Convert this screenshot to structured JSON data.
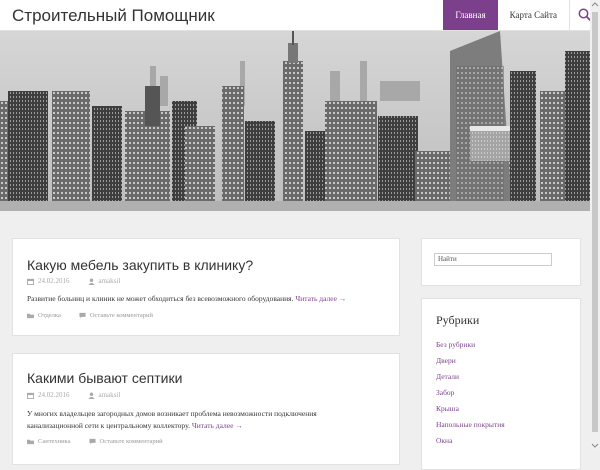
{
  "header": {
    "site_title": "Строительный Помощник",
    "nav": [
      {
        "label": "Главная",
        "active": true
      },
      {
        "label": "Карта Сайта",
        "active": false
      }
    ],
    "search_icon": "magnifier-icon",
    "accent_color": "#7b3f8c"
  },
  "posts": [
    {
      "title": "Какую мебель закупить в клинику?",
      "date": "24.02.2016",
      "author": "amaksil",
      "excerpt": "Развитие больниц и клиник не может обходиться без всевозможного оборудования.",
      "read_more": "Читать далее →",
      "category": "Отделка",
      "comment_link": "Оставьте комментарий"
    },
    {
      "title": "Какими бывают септики",
      "date": "24.02.2016",
      "author": "amaksil",
      "excerpt": "У многих владельцев загородных домов возникает проблема невозможности подключения канализационной сети к центральному коллектору.",
      "read_more": "Читать далее →",
      "category": "Сантехника",
      "comment_link": "Оставьте комментарий"
    }
  ],
  "sidebar": {
    "search_placeholder": "Найти",
    "categories_title": "Рубрики",
    "categories": [
      "Без рубрики",
      "Двери",
      "Детали",
      "Забор",
      "Крыша",
      "Напольные покрытия",
      "Окна"
    ]
  }
}
